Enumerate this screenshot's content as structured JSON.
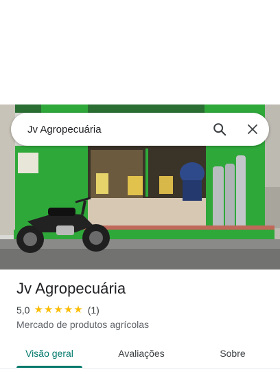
{
  "search": {
    "query": "Jv Agropecuária",
    "search_icon": "search-icon",
    "close_icon": "close-icon"
  },
  "place": {
    "name": "Jv Agropecuária",
    "rating": "5,0",
    "stars": 5,
    "review_count": "(1)",
    "category": "Mercado de produtos agrícolas"
  },
  "tabs": [
    {
      "label": "Visão geral",
      "active": true
    },
    {
      "label": "Avaliações",
      "active": false
    },
    {
      "label": "Sobre",
      "active": false
    }
  ],
  "colors": {
    "accent": "#00796b",
    "star": "#fbbc04",
    "storefront_green": "#2fa83a"
  }
}
